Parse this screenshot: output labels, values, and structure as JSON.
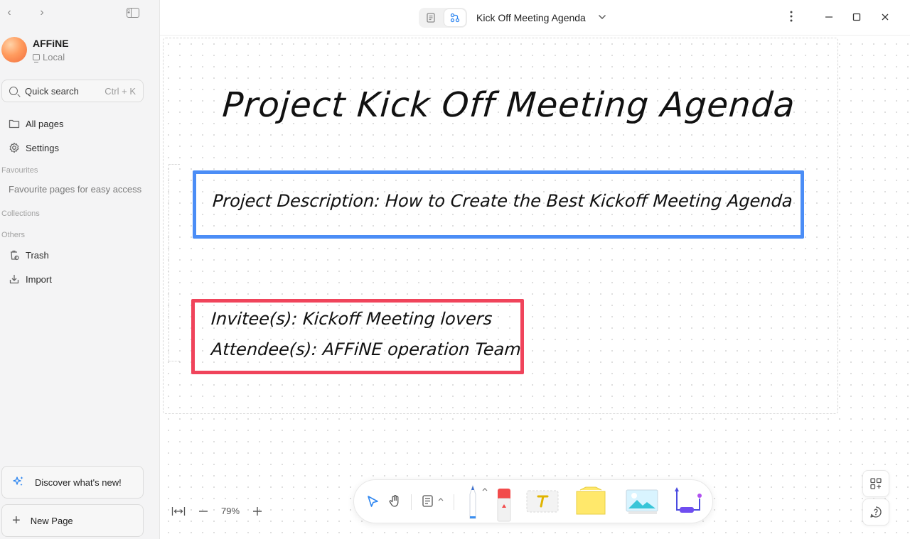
{
  "workspace": {
    "name": "AFFiNE",
    "storage": "Local"
  },
  "search": {
    "label": "Quick search",
    "shortcut": "Ctrl + K"
  },
  "sidebar": {
    "items": [
      {
        "label": "All pages",
        "icon": "folder-icon"
      },
      {
        "label": "Settings",
        "icon": "gear-icon"
      }
    ],
    "favourites_label": "Favourites",
    "favourites_placeholder": "Favourite pages for easy access",
    "collections_label": "Collections",
    "others_label": "Others",
    "others_items": [
      {
        "label": "Trash",
        "icon": "trash-icon"
      },
      {
        "label": "Import",
        "icon": "import-icon"
      }
    ],
    "discover_label": "Discover what's new!",
    "new_page_label": "New Page"
  },
  "header": {
    "title": "Kick Off Meeting Agenda",
    "active_mode": "edgeless"
  },
  "canvas": {
    "title": "Project Kick Off Meeting Agenda",
    "description": "Project Description: How to Create the Best Kickoff Meeting Agenda",
    "invitees": "Invitee(s): Kickoff Meeting lovers",
    "attendees": "Attendee(s): AFFiNE operation Team",
    "colors": {
      "blue_box": "#4b8df6",
      "red_box": "#f0445b"
    }
  },
  "zoom": {
    "level": "79%"
  },
  "toolbar": {
    "tools": [
      "select-tool",
      "hand-tool",
      "frame-tool",
      "pen-tool",
      "eraser-tool",
      "text-tool",
      "note-tool",
      "image-tool",
      "connector-tool"
    ]
  }
}
